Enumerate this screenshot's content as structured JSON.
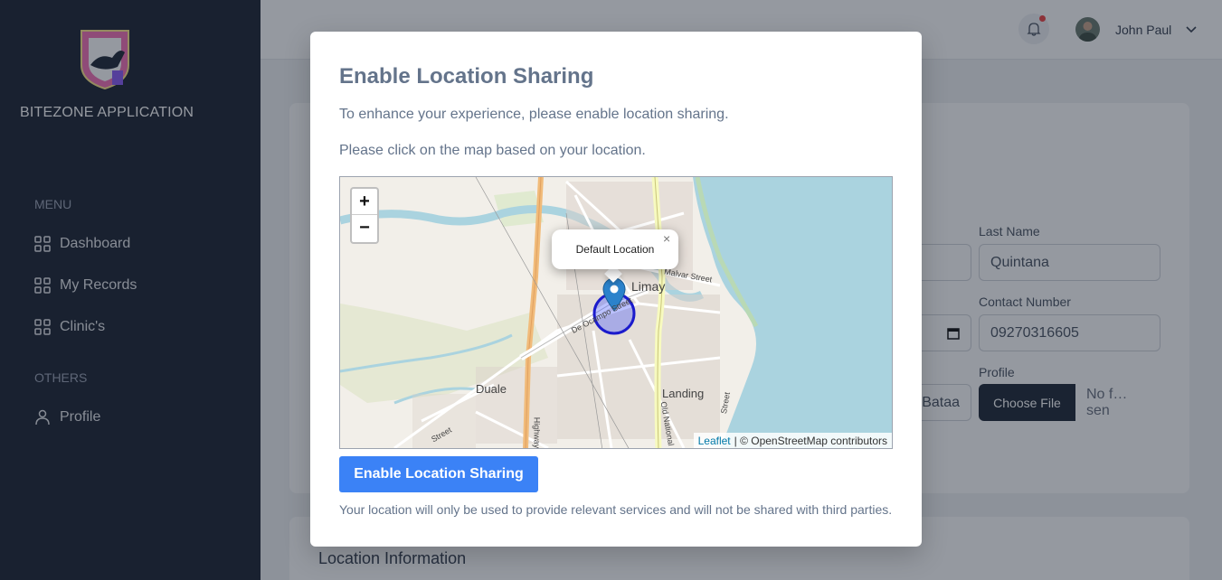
{
  "sidebar": {
    "brand": "BITEZONE APPLICATION",
    "menu_label": "MENU",
    "items": [
      {
        "label": "Dashboard"
      },
      {
        "label": "My Records"
      },
      {
        "label": "Clinic's"
      }
    ],
    "others_label": "OTHERS",
    "profile_label": "Profile"
  },
  "header": {
    "user_name": "John Paul"
  },
  "form": {
    "last_name_label": "Last Name",
    "last_name_value": "Quintana",
    "contact_label": "Contact Number",
    "contact_value": "09270316605",
    "address_partial": "Bataa",
    "profile_label": "Profile",
    "choose_file": "Choose File",
    "no_file": "No f…sen",
    "location_title": "Location Information"
  },
  "modal": {
    "title": "Enable Location Sharing",
    "line1": "To enhance your experience, please enable location sharing.",
    "line2": "Please click on the map based on your location.",
    "button": "Enable Location Sharing",
    "disclaimer": "Your location will only be used to provide relevant services and will not be shared with third parties."
  },
  "map": {
    "zoom_in": "+",
    "zoom_out": "−",
    "popup": "Default Location",
    "popup_close": "×",
    "attribution_link": "Leaflet",
    "attribution_text": "| © OpenStreetMap contributors",
    "labels": {
      "limay": "Limay",
      "malvar": "Malvar Street",
      "deocampo": "De Ocampo Street",
      "duale": "Duale",
      "landing": "Landing",
      "street": "Street",
      "highway": "Highway",
      "oldnational": "Old National",
      "extra_street": "Street"
    }
  },
  "colors": {
    "sidebar_bg": "#1e2533",
    "primary": "#3b82f6",
    "water": "#aad3df",
    "marker": "#2b82cb"
  }
}
